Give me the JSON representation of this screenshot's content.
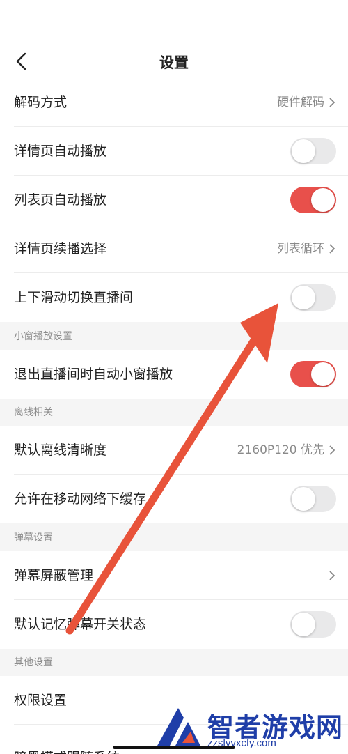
{
  "header": {
    "title": "设置"
  },
  "rows": {
    "decode": {
      "label": "解码方式",
      "value": "硬件解码"
    },
    "detail_autoplay": {
      "label": "详情页自动播放",
      "on": false
    },
    "list_autoplay": {
      "label": "列表页自动播放",
      "on": true
    },
    "detail_continue": {
      "label": "详情页续播选择",
      "value": "列表循环"
    },
    "swipe_live": {
      "label": "上下滑动切换直播间",
      "on": false
    },
    "exit_live_mini": {
      "label": "退出直播间时自动小窗播放",
      "on": true
    },
    "offline_quality": {
      "label": "默认离线清晰度",
      "value": "2160P120 优先"
    },
    "mobile_cache": {
      "label": "允许在移动网络下缓存",
      "on": false
    },
    "danmaku_block": {
      "label": "弹幕屏蔽管理"
    },
    "danmaku_memory": {
      "label": "默认记忆弹幕开关状态",
      "on": false
    },
    "permissions": {
      "label": "权限设置"
    },
    "dark_mode": {
      "label": "暗黑模式跟随系统"
    }
  },
  "sections": {
    "mini_window": "小窗播放设置",
    "offline": "离线相关",
    "danmaku": "弹幕设置",
    "other": "其他设置"
  },
  "watermark": {
    "text": "智者游戏网",
    "url": "zzslyyxcfy.com"
  },
  "colors": {
    "accent": "#e8504b",
    "annotation_arrow": "#e8533a",
    "watermark": "#1f3ea8"
  }
}
